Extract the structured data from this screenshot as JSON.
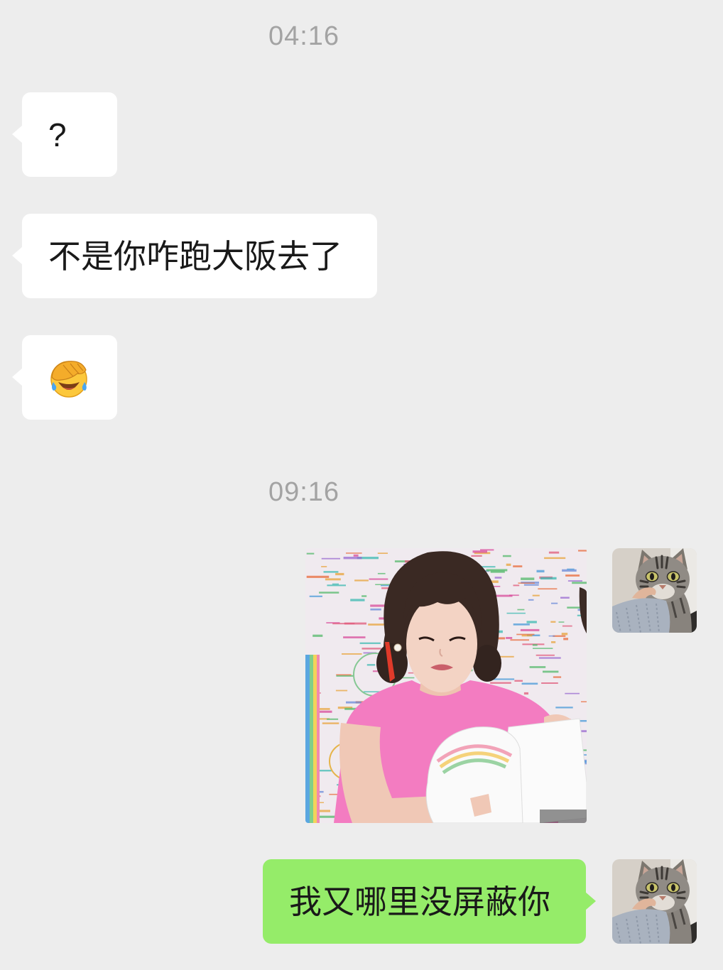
{
  "colors": {
    "background": "#ededed",
    "incoming_bubble": "#ffffff",
    "outgoing_bubble": "#95ec69",
    "timestamp_text": "#a3a3a3",
    "message_text": "#191919"
  },
  "chat": {
    "timestamps": [
      "04:16",
      "09:16"
    ],
    "incoming": [
      {
        "text": "?"
      },
      {
        "text": "不是你咋跑大阪去了"
      },
      {
        "icon": "facepalm-emoji-icon"
      }
    ],
    "outgoing": [
      {
        "text": "我又哪里没屏蔽你"
      }
    ],
    "self_avatar_icon": "cat-avatar-icon"
  }
}
